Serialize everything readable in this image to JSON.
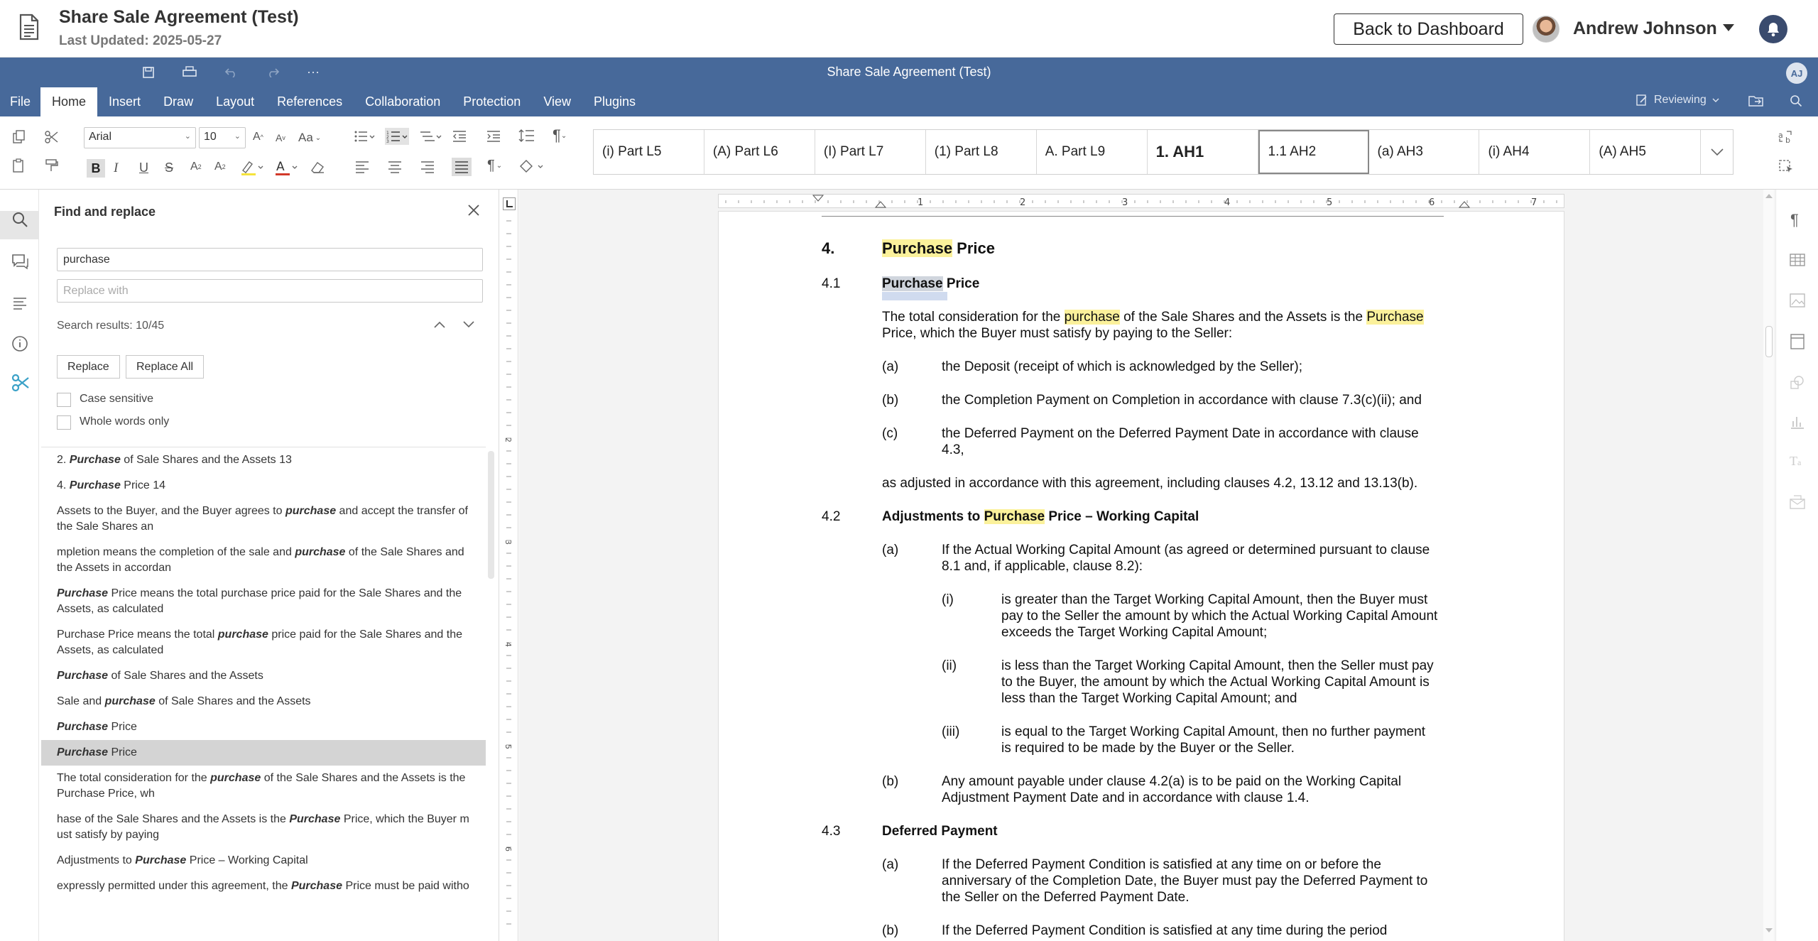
{
  "app": {
    "doc_title": "Share Sale Agreement (Test)",
    "last_updated": "Last Updated: 2025-05-27",
    "back_label": "Back to Dashboard",
    "user_name": "Andrew Johnson"
  },
  "editor": {
    "title": "Share Sale Agreement (Test)",
    "avatar_initials": "AJ",
    "menu": [
      "File",
      "Home",
      "Insert",
      "Draw",
      "Layout",
      "References",
      "Collaboration",
      "Protection",
      "View",
      "Plugins"
    ],
    "active_tab": "Home",
    "reviewing_label": "Reviewing",
    "accent": "#47699a"
  },
  "toolbar": {
    "font_family": "Arial",
    "font_size": "10",
    "styles": [
      "(i) Part L5",
      "(A) Part L6",
      "(I) Part L7",
      "(1) Part L8",
      "A. Part L9",
      "1. AH1",
      "1.1 AH2",
      "(a) AH3",
      "(i) AH4",
      "(A) AH5"
    ],
    "selected_style": "1.1 AH2"
  },
  "find": {
    "title": "Find and replace",
    "query": "purchase",
    "replace_placeholder": "Replace with",
    "results_label": "Search results: 10/45",
    "replace_btn": "Replace",
    "replace_all_btn": "Replace All",
    "case_sensitive": "Case sensitive",
    "whole_words": "Whole words only",
    "selected_index": 10,
    "results": [
      {
        "pre": "2. ",
        "match": "Purchase",
        "post": " of Sale Shares and the Assets 13"
      },
      {
        "pre": "4. ",
        "match": "Purchase",
        "post": " Price 14"
      },
      {
        "pre": "Assets to the Buyer, and the Buyer agrees to ",
        "match": "purchase",
        "post": " and accept the transfer of the Sale Shares an"
      },
      {
        "pre": "mpletion means the completion of the sale and ",
        "match": "purchase",
        "post": " of the Sale Shares and the Assets in accordan"
      },
      {
        "pre": "",
        "match": "Purchase",
        "post": " Price means the total purchase price paid for the Sale Shares and the Assets, as calculated"
      },
      {
        "pre": "Purchase Price means the total ",
        "match": "purchase",
        "post": " price paid for the Sale Shares and the Assets, as calculated"
      },
      {
        "pre": "",
        "match": "Purchase",
        "post": " of Sale Shares and the Assets"
      },
      {
        "pre": "Sale and ",
        "match": "purchase",
        "post": " of Sale Shares and the Assets"
      },
      {
        "pre": "",
        "match": "Purchase",
        "post": " Price"
      },
      {
        "pre": "",
        "match": "Purchase",
        "post": " Price"
      },
      {
        "pre": "The total consideration for the ",
        "match": "purchase",
        "post": " of the Sale Shares and the Assets is the Purchase Price, wh"
      },
      {
        "pre": "hase of the Sale Shares and the Assets is the ",
        "match": "Purchase",
        "post": " Price, which the Buyer m ust satisfy by paying"
      },
      {
        "pre": "Adjustments to ",
        "match": "Purchase",
        "post": " Price – Working Capital"
      },
      {
        "pre": "expressly permitted under this agreement, the ",
        "match": "Purchase",
        "post": " Price must be paid witho"
      }
    ]
  },
  "document": {
    "h4_num": "4.",
    "h4_word": "Purchase",
    "h4_rest": " Price",
    "c41_num": "4.1",
    "c41_word": "Purchase",
    "c41_rest": " Price",
    "c41_p1a": "The total consideration for the ",
    "c41_p1b": "purchase",
    "c41_p1c": " of the Sale Shares and the Assets is the ",
    "c41_p1d": "Purchase",
    "c41_p2": "Price, which the Buyer must satisfy by paying to the Seller:",
    "a_lbl": "(a)",
    "a_txt": "the Deposit (receipt of which is acknowledged by the Seller);",
    "b_lbl": "(b)",
    "b_txt": "the Completion Payment on Completion in accordance with clause 7.3(c)(ii); and",
    "c_lbl": "(c)",
    "c_txt1": "the Deferred Payment on the Deferred Payment Date in accordance with clause",
    "c_txt2": "4.3,",
    "adjusted": "as adjusted in accordance with this agreement, including clauses 4.2, 13.12 and 13.13(b).",
    "c42_num": "4.2",
    "c42_pre": "Adjustments to ",
    "c42_word": "Purchase",
    "c42_post": " Price – Working Capital",
    "c42a_lbl": "(a)",
    "c42a_1": "If the Actual Working Capital Amount (as agreed or determined pursuant to clause",
    "c42a_2": "8.1 and, if applicable, clause 8.2):",
    "i_lbl": "(i)",
    "i_1": "is greater than the Target Working Capital Amount, then the Buyer must",
    "i_2": "pay to the Seller the amount by which the Actual Working Capital Amount",
    "i_3": "exceeds the Target Working Capital Amount;",
    "ii_lbl": "(ii)",
    "ii_1": "is less than the Target Working Capital Amount, then the Seller must pay",
    "ii_2": "to the Buyer, the amount by which the Actual Working Capital Amount is",
    "ii_3": "less than the Target Working Capital Amount; and",
    "iii_lbl": "(iii)",
    "iii_1": "is equal to the Target Working Capital Amount, then no further payment",
    "iii_2": "is required to be made by the Buyer or the Seller.",
    "c42b_lbl": "(b)",
    "c42b_1": "Any amount payable under clause 4.2(a) is to be paid on the Working Capital",
    "c42b_2": "Adjustment Payment Date and in accordance with clause 1.4.",
    "c43_num": "4.3",
    "c43_title": "Deferred Payment",
    "c43a_lbl": "(a)",
    "c43a_1": "If the Deferred Payment Condition is satisfied at any time on or before the",
    "c43a_2": "anniversary of the Completion Date, the Buyer must pay the Deferred Payment to",
    "c43a_3": "the Seller on the Deferred Payment Date.",
    "c43b_lbl": "(b)",
    "c43b_1": "If the Deferred Payment Condition is satisfied at any time during the period",
    "ruler_numbers": [
      "1",
      "2",
      "3",
      "4",
      "5",
      "6",
      "7"
    ]
  }
}
